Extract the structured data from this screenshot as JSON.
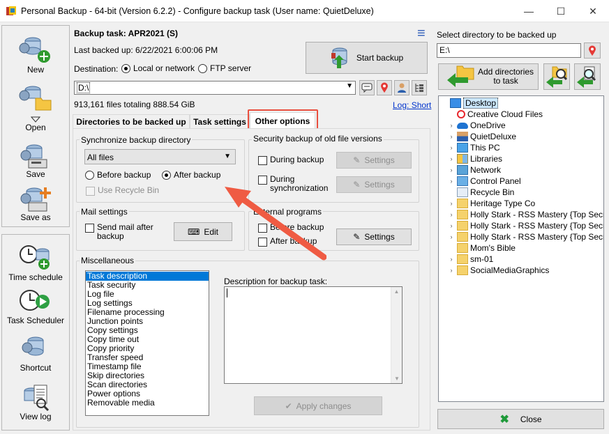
{
  "window": {
    "title": "Personal Backup - 64-bit (Version 6.2.2) - Configure backup task (User name: QuietDeluxe)",
    "minimize": "—",
    "maximize": "☐",
    "close": "✕"
  },
  "toolbar": {
    "new": "New",
    "open": "Open",
    "save": "Save",
    "save_as": "Save as",
    "time_schedule": "Time schedule",
    "task_scheduler": "Task Scheduler",
    "shortcut": "Shortcut",
    "view_log": "View log"
  },
  "task": {
    "title": "Backup task: APR2021 (S)",
    "last_backed_up": "Last backed up: 6/22/2021 6:00:06 PM",
    "menu_icon": "≡",
    "start_backup": "Start backup",
    "destination_label": "Destination:",
    "dest_local": "Local or network",
    "dest_ftp": "FTP server",
    "destination_value": "D:\\",
    "files_summary": "913,161 files totaling 888.54 GiB",
    "log_short": "Log: Short"
  },
  "tabs": [
    {
      "label": "Directories to be backed up"
    },
    {
      "label": "Task settings"
    },
    {
      "label": "Other options"
    }
  ],
  "sync": {
    "group_label": "Synchronize backup directory",
    "select_value": "All files",
    "before_backup": "Before backup",
    "after_backup": "After backup",
    "use_recycle_bin": "Use Recycle Bin"
  },
  "security": {
    "group_label": "Security backup of old file versions",
    "during_backup": "During backup",
    "during_sync_1": "During",
    "during_sync_2": "synchronization",
    "settings": "Settings"
  },
  "mail": {
    "group_label": "Mail settings",
    "send_mail_1": "Send mail after",
    "send_mail_2": "backup",
    "edit": "Edit"
  },
  "external": {
    "group_label": "External programs",
    "before_backup": "Before backup",
    "after_backup": "After backup",
    "settings": "Settings"
  },
  "misc": {
    "group_label": "Miscellaneous",
    "items": [
      "Task description",
      "Task security",
      "Log file",
      "Log settings",
      "Filename processing",
      "Junction points",
      "Copy settings",
      "Copy time out",
      "Copy priority",
      "Transfer speed",
      "Timestamp file",
      "Skip directories",
      "Scan directories",
      "Power options",
      "Removable media"
    ],
    "description_label": "Description for backup task:",
    "apply_changes": "Apply changes"
  },
  "right": {
    "select_dir_label": "Select directory to be backed up",
    "dir_value": "E:\\",
    "add_directories_1": "Add directories",
    "add_directories_2": "to task",
    "tree": [
      {
        "label": "Desktop",
        "icon": "desktop-icon",
        "expander": "",
        "indent": 0
      },
      {
        "label": "Creative Cloud Files",
        "icon": "creative-cloud-icon",
        "expander": "",
        "indent": 1
      },
      {
        "label": "OneDrive",
        "icon": "onedrive-icon",
        "expander": "›",
        "indent": 1
      },
      {
        "label": "QuietDeluxe",
        "icon": "user-icon",
        "expander": "›",
        "indent": 1
      },
      {
        "label": "This PC",
        "icon": "pc-icon",
        "expander": "›",
        "indent": 1
      },
      {
        "label": "Libraries",
        "icon": "libraries-icon",
        "expander": "›",
        "indent": 1
      },
      {
        "label": "Network",
        "icon": "network-icon",
        "expander": "›",
        "indent": 1
      },
      {
        "label": "Control Panel",
        "icon": "control-panel-icon",
        "expander": "›",
        "indent": 1
      },
      {
        "label": "Recycle Bin",
        "icon": "recycle-bin-icon",
        "expander": "",
        "indent": 1
      },
      {
        "label": "Heritage Type Co",
        "icon": "folder-icon",
        "expander": "›",
        "indent": 1
      },
      {
        "label": "Holly Stark - RSS Mastery {Top Secret R",
        "icon": "folder-icon",
        "expander": "›",
        "indent": 1
      },
      {
        "label": "Holly Stark - RSS Mastery {Top Secret R",
        "icon": "folder-icon",
        "expander": "›",
        "indent": 1
      },
      {
        "label": "Holly Stark - RSS Mastery {Top Secret R",
        "icon": "folder-icon",
        "expander": "›",
        "indent": 1
      },
      {
        "label": "Mom's Bible",
        "icon": "folder-icon",
        "expander": "",
        "indent": 1
      },
      {
        "label": "sm-01",
        "icon": "folder-icon",
        "expander": "›",
        "indent": 1
      },
      {
        "label": "SocialMediaGraphics",
        "icon": "folder-icon",
        "expander": "›",
        "indent": 1
      }
    ],
    "close": "Close"
  },
  "colors": {
    "accent": "#0078d7",
    "highlight_box": "#e94f3f",
    "arrow": "#ef5b43",
    "green": "#2f9a2f",
    "close_x": "#1f9a3a"
  }
}
